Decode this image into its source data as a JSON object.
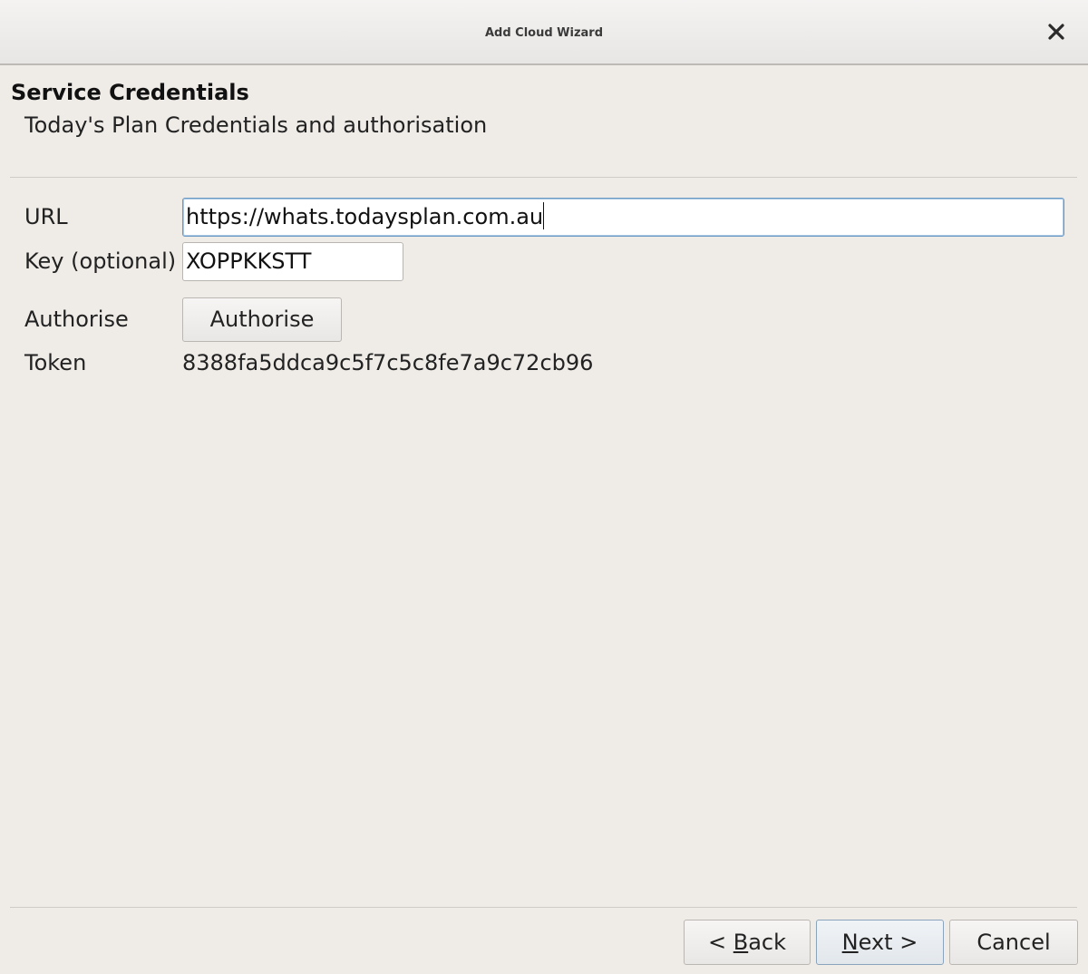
{
  "window": {
    "title": "Add Cloud Wizard",
    "close_icon": "close-icon"
  },
  "header": {
    "title": "Service Credentials",
    "subtitle": "Today's Plan Credentials and authorisation"
  },
  "form": {
    "url": {
      "label": "URL",
      "value": "https://whats.todaysplan.com.au"
    },
    "key": {
      "label": "Key (optional)",
      "value": "XOPPKKSTT"
    },
    "authorise": {
      "label": "Authorise",
      "button_label": "Authorise"
    },
    "token": {
      "label": "Token",
      "value": "8388fa5ddca9c5f7c5c8fe7a9c72cb96"
    }
  },
  "footer": {
    "back": {
      "prefix": "< ",
      "mnemonic": "B",
      "rest": "ack"
    },
    "next": {
      "mnemonic": "N",
      "rest": "ext >"
    },
    "cancel": "Cancel"
  }
}
